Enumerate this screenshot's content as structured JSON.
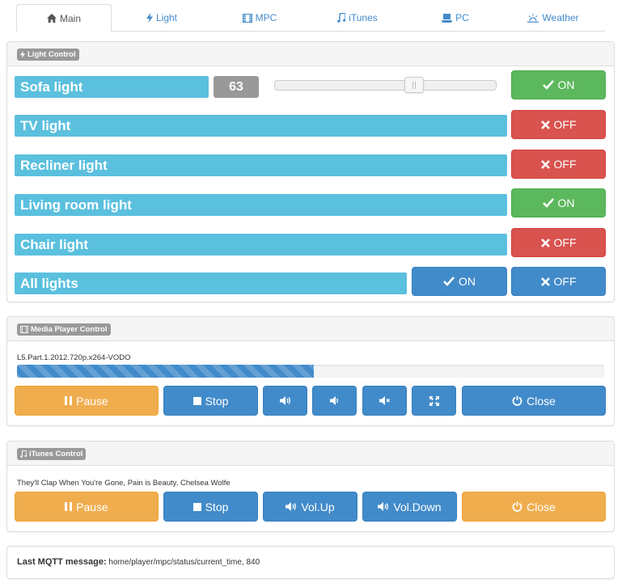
{
  "tabs": [
    {
      "label": "Main",
      "icon": "home-icon",
      "active": true
    },
    {
      "label": "Light",
      "icon": "bolt-icon"
    },
    {
      "label": "MPC",
      "icon": "film-icon"
    },
    {
      "label": "iTunes",
      "icon": "music-icon"
    },
    {
      "label": "PC",
      "icon": "computer-icon"
    },
    {
      "label": "Weather",
      "icon": "sun-icon"
    }
  ],
  "light_panel": {
    "heading": "Light Control",
    "sofa": {
      "name": "Sofa light",
      "value": "63",
      "slider_fraction": 0.63,
      "state_label": "ON"
    },
    "tv": {
      "name": "TV light",
      "state_label": "OFF"
    },
    "recliner": {
      "name": "Recliner light",
      "state_label": "OFF"
    },
    "living": {
      "name": "Living room light",
      "state_label": "ON"
    },
    "chair": {
      "name": "Chair light",
      "state_label": "OFF"
    },
    "all": {
      "name": "All lights",
      "on_label": "ON",
      "off_label": "OFF"
    }
  },
  "media_panel": {
    "heading": "Media Player Control",
    "now_playing": "L5.Part.1.2012.720p.x264-VODO",
    "progress_percent": 50.5,
    "pause_label": "Pause",
    "stop_label": "Stop",
    "close_label": "Close"
  },
  "itunes_panel": {
    "heading": "iTunes Control",
    "now_playing": "They'll Clap When You're Gone, Pain is Beauty, Chelsea Wolfe",
    "pause_label": "Pause",
    "stop_label": "Stop",
    "volup_label": "Vol.Up",
    "voldown_label": "Vol.Down",
    "close_label": "Close"
  },
  "mqtt": {
    "label": "Last MQTT message:",
    "message": "home/player/mpc/status/current_time, 840"
  },
  "colors": {
    "info": "#5bc0de",
    "success": "#5cb85c",
    "danger": "#d9534f",
    "primary": "#428bca",
    "warning": "#f0ad4e"
  }
}
